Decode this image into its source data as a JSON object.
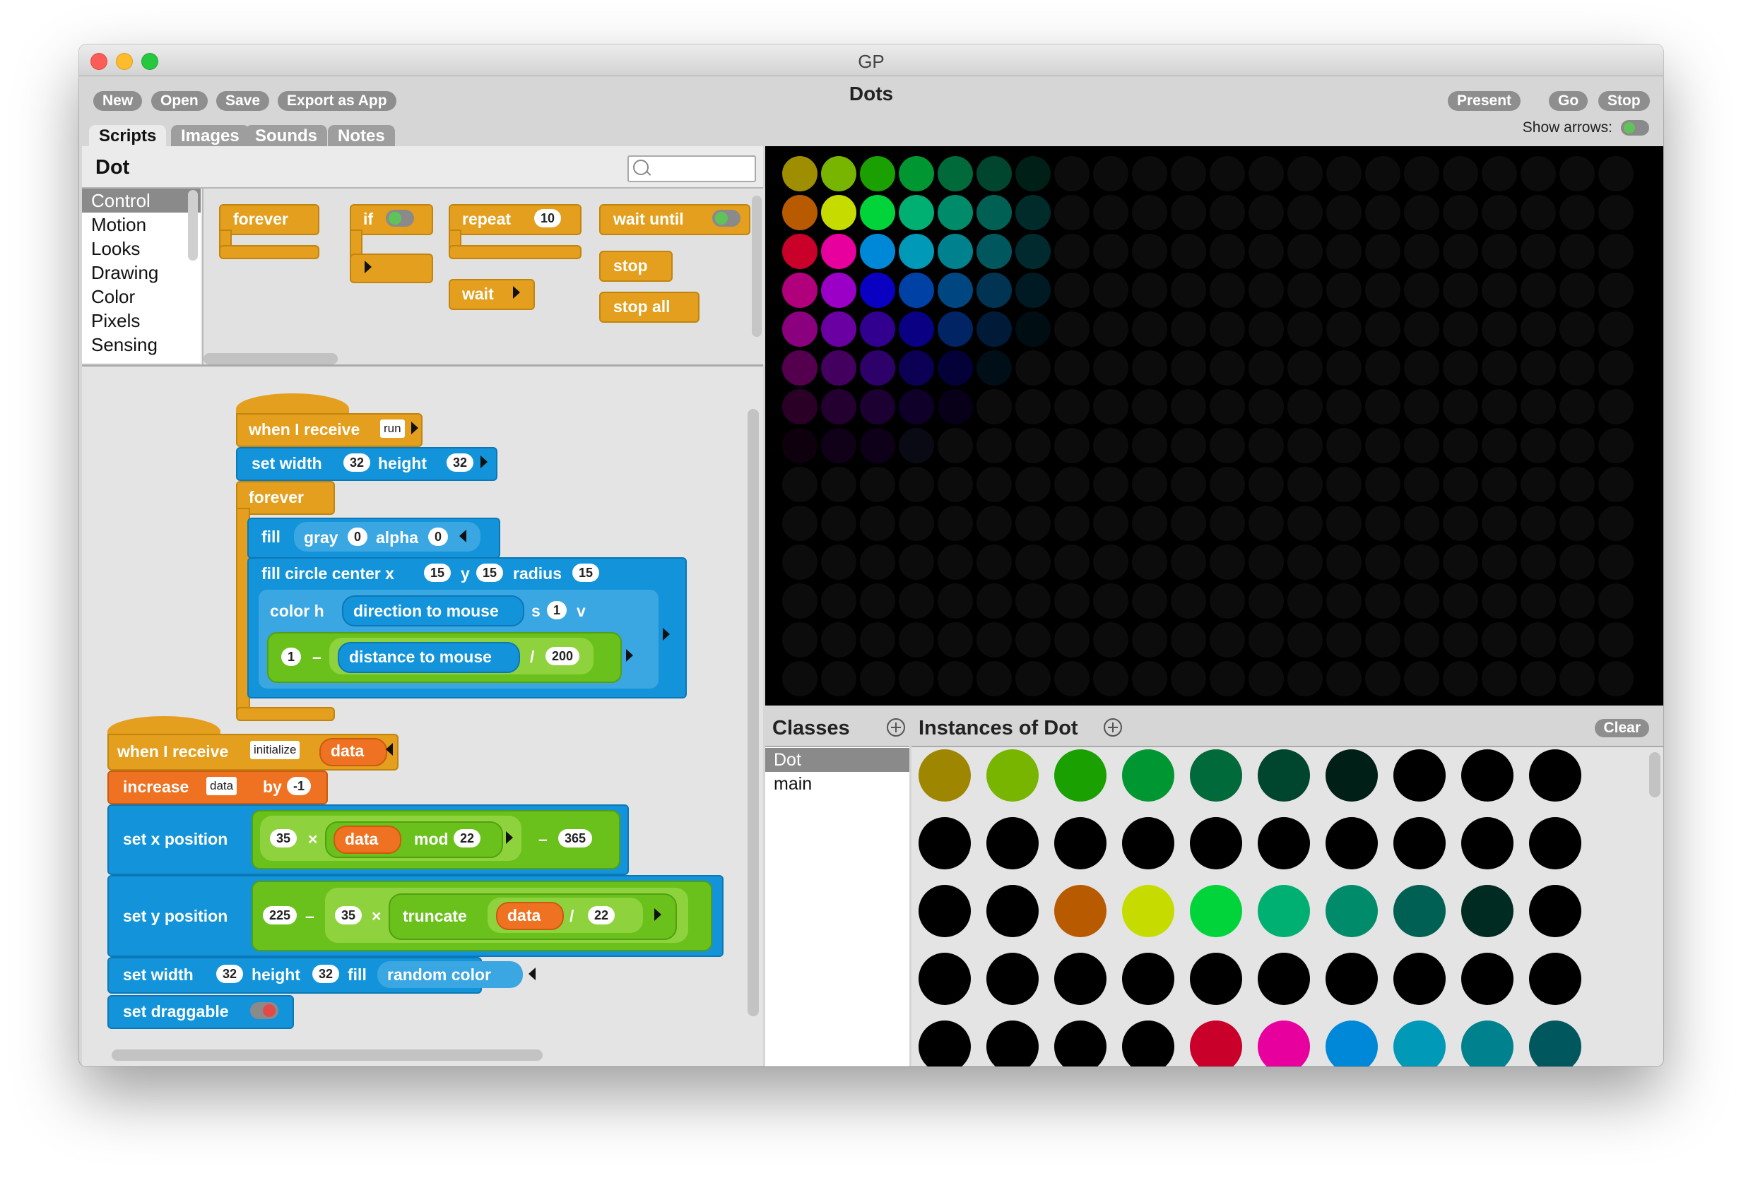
{
  "window": {
    "title": "GP",
    "project_title": "Dots"
  },
  "toolbar": {
    "new_label": "New",
    "open_label": "Open",
    "save_label": "Save",
    "export_label": "Export as App",
    "present_label": "Present",
    "go_label": "Go",
    "stop_label": "Stop",
    "show_arrows_label": "Show arrows:"
  },
  "tabs": [
    "Scripts",
    "Images",
    "Sounds",
    "Notes"
  ],
  "class_header": {
    "name": "Dot"
  },
  "categories": [
    "Control",
    "Motion",
    "Looks",
    "Drawing",
    "Color",
    "Pixels",
    "Sensing"
  ],
  "palette": {
    "forever": "forever",
    "if": "if",
    "repeat": "repeat",
    "repeat_count": "10",
    "wait_until": "wait until",
    "wait": "wait",
    "stop": "stop",
    "stop_all": "stop all"
  },
  "script1": {
    "when_receive": "when I receive",
    "message": "run",
    "set_width": "set width",
    "width": "32",
    "height_label": "height",
    "height": "32",
    "forever": "forever",
    "fill": "fill",
    "gray": "gray",
    "gray_value": "0",
    "alpha": "alpha",
    "alpha_value": "0",
    "fill_circle": "fill circle center x",
    "x_value": "15",
    "y_label": "y",
    "y_value": "15",
    "radius_label": "radius",
    "radius_value": "15",
    "color_h": "color h",
    "direction": "direction to mouse",
    "s_label": "s",
    "s_value": "1",
    "v_label": "v",
    "one": "1",
    "minus": "–",
    "distance": "distance to mouse",
    "divide": "/",
    "divisor": "200"
  },
  "script2": {
    "when_receive": "when I receive",
    "message": "initialize",
    "param": "data",
    "increase": "increase",
    "var_name": "data",
    "by_label": "by",
    "by_value": "-1",
    "set_x": "set x position",
    "x_mult": "35",
    "times": "×",
    "data": "data",
    "mod": "mod",
    "mod_value": "22",
    "minus": "–",
    "x_offset": "365",
    "set_y": "set y position",
    "y_base": "225",
    "y_mult": "35",
    "truncate": "truncate",
    "divide": "/",
    "y_div": "22",
    "set_width": "set width",
    "width": "32",
    "height_label": "height",
    "height": "32",
    "fill_label": "fill",
    "random_color": "random color",
    "set_draggable": "set draggable"
  },
  "stage": {
    "background": "#000000",
    "empty_dot_color": "#0c0c0c",
    "dot_rows": [
      [
        "#9f8f00",
        "#78b500",
        "#1aa000",
        "#009733",
        "#006a3a",
        "#00452d",
        "#001f16"
      ],
      [
        "#b85a00",
        "#c6dc00",
        "#00d43a",
        "#00b073",
        "#008c6b",
        "#006053",
        "#002b2b"
      ],
      [
        "#c8002a",
        "#e8009e",
        "#0088d8",
        "#0099b8",
        "#00818e",
        "#00585e",
        "#002a2e"
      ],
      [
        "#b0007c",
        "#9a00c6",
        "#0a00c2",
        "#0041a6",
        "#004680",
        "#003452",
        "#001a24"
      ],
      [
        "#8a007e",
        "#6a00a2",
        "#32008e",
        "#0a0084",
        "#002464",
        "#001a38",
        "#000e14"
      ],
      [
        "#54004e",
        "#43005e",
        "#2e006a",
        "#0c0054",
        "#040038",
        "#000e18"
      ],
      [
        "#2a0026",
        "#240030",
        "#1c0032",
        "#0e0028",
        "#070018"
      ],
      [
        "#0f000d",
        "#100018",
        "#0e0018",
        "#0a0a14"
      ]
    ]
  },
  "classes_panel": {
    "title": "Classes",
    "items": [
      "Dot",
      "main"
    ]
  },
  "instances_panel": {
    "title": "Instances of Dot",
    "clear_label": "Clear",
    "rows": [
      [
        "#9f8600",
        "#78b500",
        "#1aa000",
        "#009733",
        "#006a3a",
        "#00452d",
        "#001f16",
        "#000000",
        "#000000",
        "#000000"
      ],
      [
        "#000000",
        "#000000",
        "#000000",
        "#000000",
        "#000000",
        "#000000",
        "#000000",
        "#000000",
        "#000000",
        "#000000"
      ],
      [
        "#000000",
        "#000000",
        "#b85a00",
        "#c6dc00",
        "#00d43a",
        "#00b073",
        "#008c6b",
        "#006053",
        "#002b22",
        "#000000"
      ],
      [
        "#000000",
        "#000000",
        "#000000",
        "#000000",
        "#000000",
        "#000000",
        "#000000",
        "#000000",
        "#000000",
        "#000000"
      ],
      [
        "#000000",
        "#000000",
        "#000000",
        "#000000",
        "#c8002a",
        "#e8009e",
        "#0088d8",
        "#0099b8",
        "#00818e",
        "#00585e"
      ]
    ]
  }
}
